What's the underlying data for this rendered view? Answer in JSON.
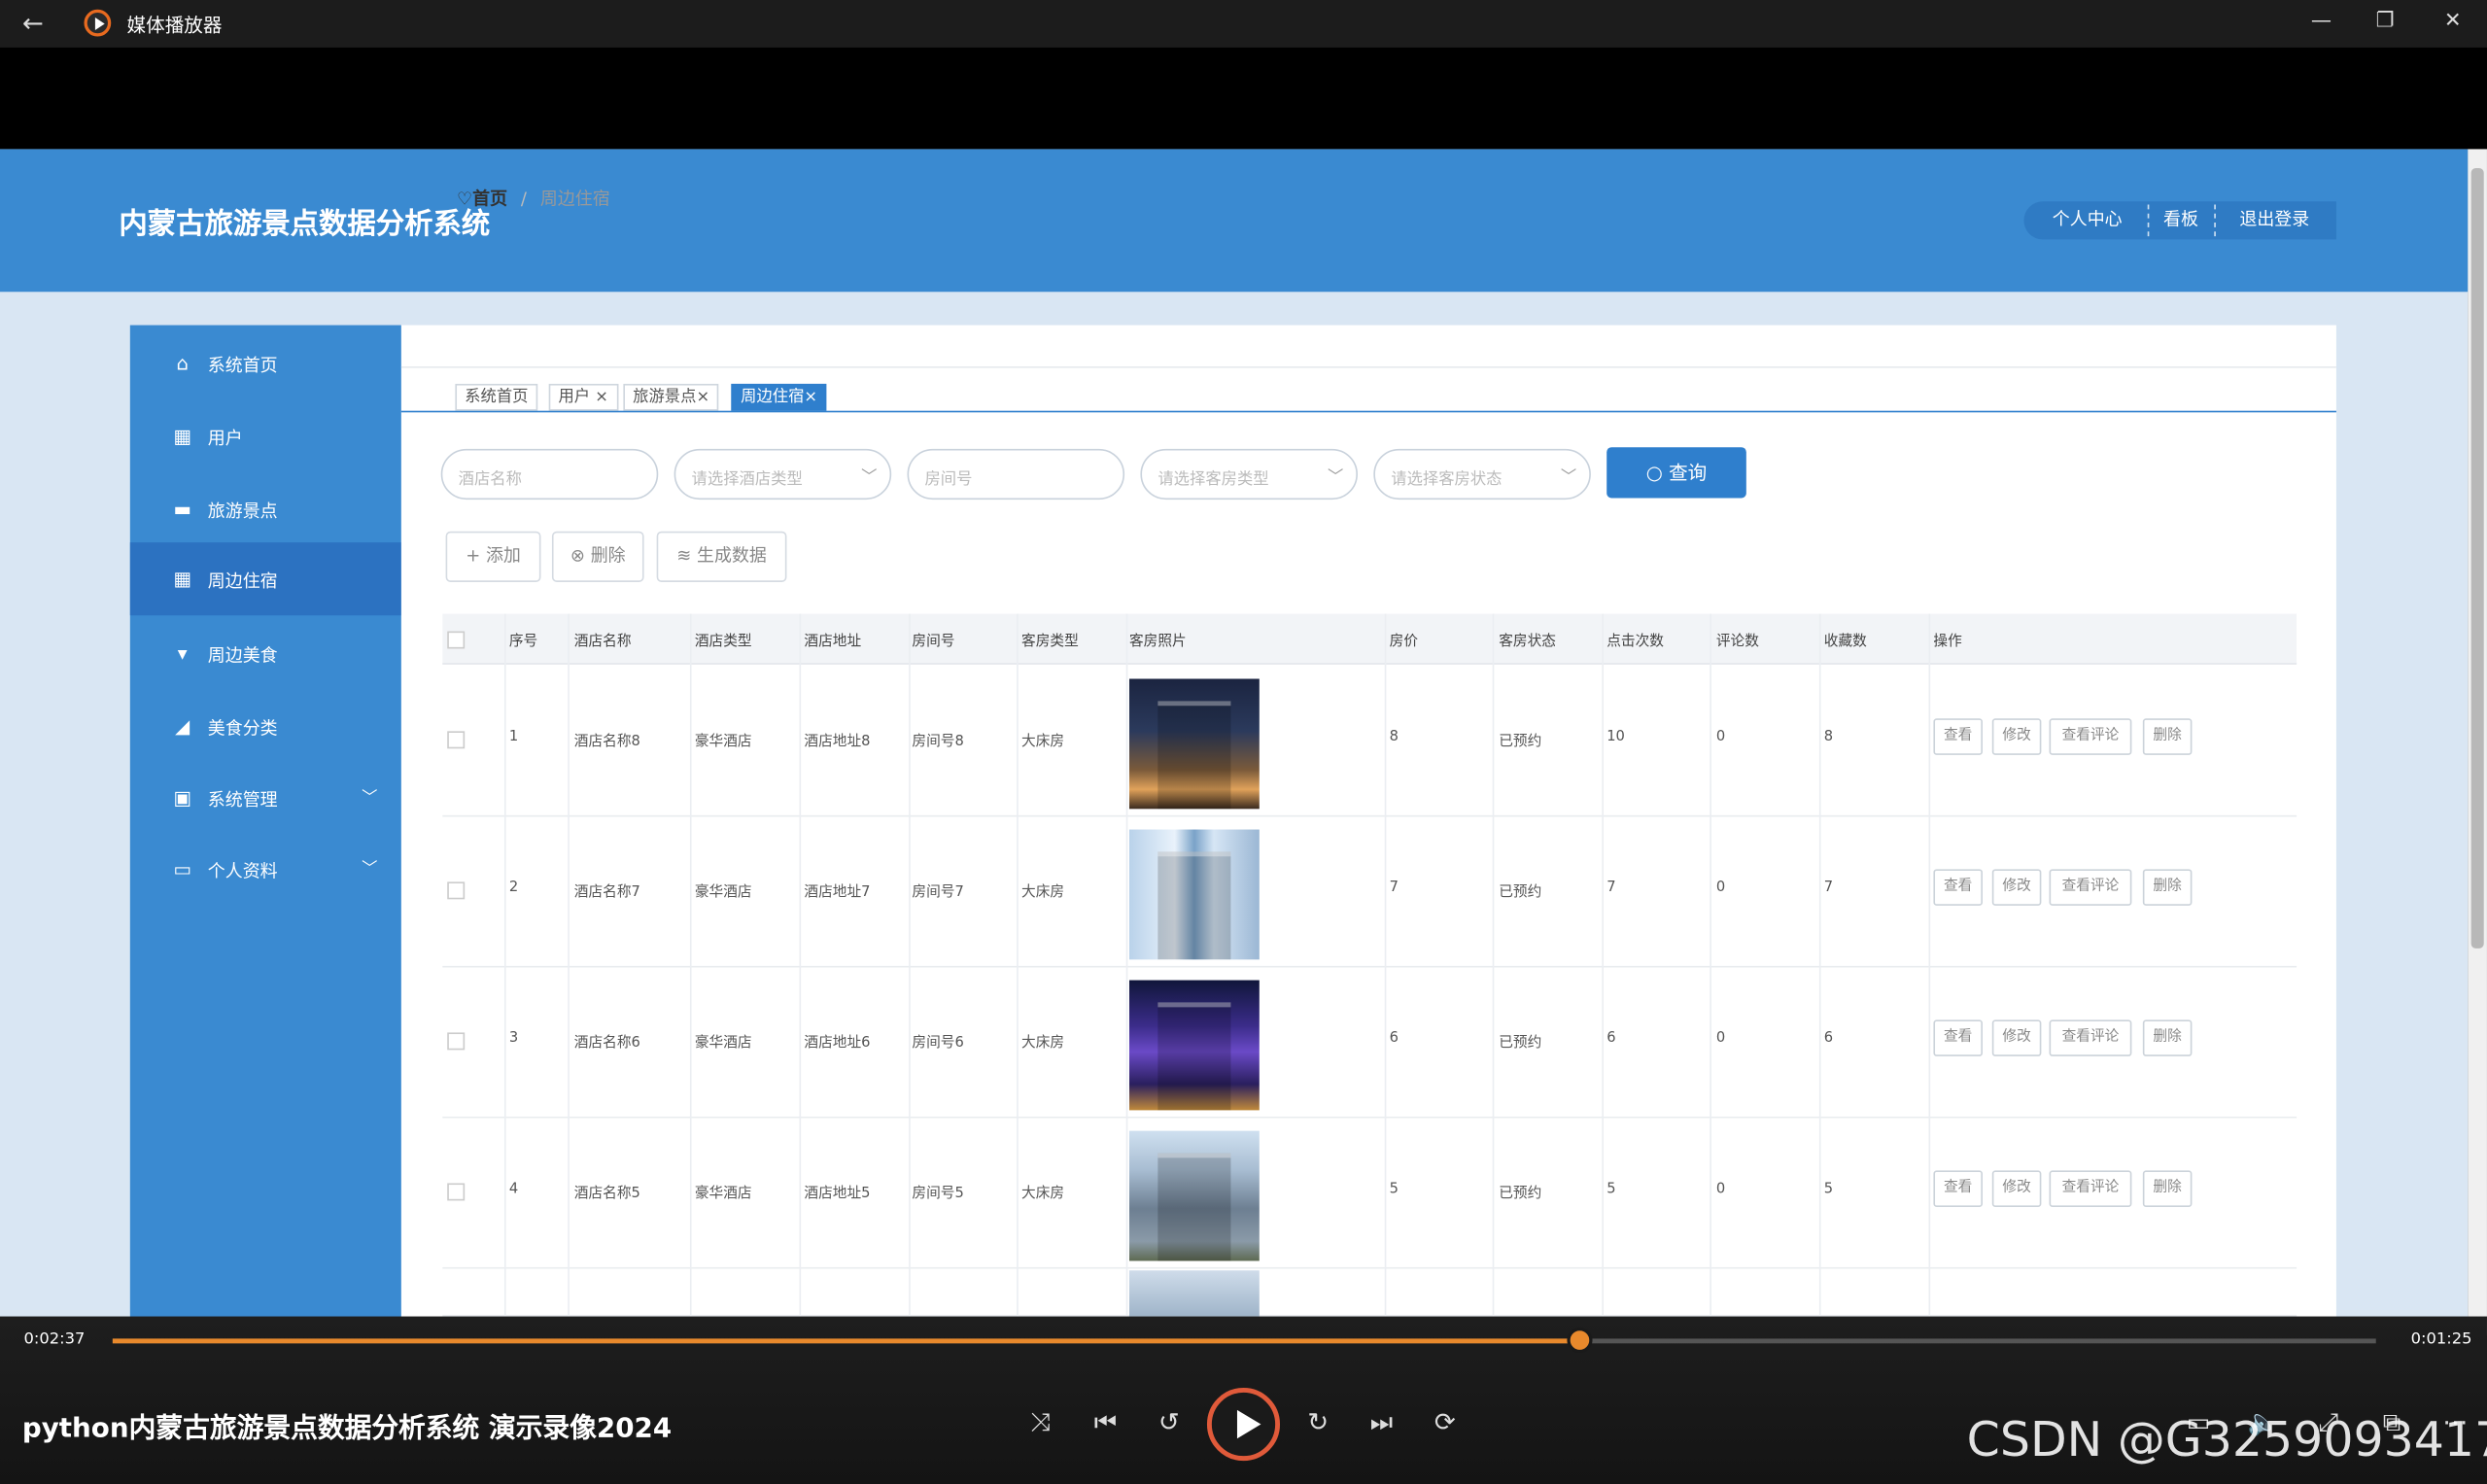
{
  "player": {
    "window_title": "媒体播放器",
    "current_time": "0:02:37",
    "total_time": "0:01:25",
    "progress": 0.648,
    "video_title": "python内蒙古旅游景点数据分析系统 演示录像2024",
    "watermark": "CSDN @G3259093417",
    "accent_color": "#e8892c"
  },
  "site": {
    "title": "内蒙古旅游景点数据分析系统",
    "nav": [
      "个人中心",
      "看板",
      "退出登录"
    ],
    "primary_color": "#3a8ad1"
  },
  "sidebar": {
    "items": [
      {
        "label": "系统首页",
        "icon": "home-icon"
      },
      {
        "label": "用户",
        "icon": "grid-icon"
      },
      {
        "label": "旅游景点",
        "icon": "chat-icon"
      },
      {
        "label": "周边住宿",
        "icon": "grid-icon",
        "active": true
      },
      {
        "label": "周边美食",
        "icon": "cup-icon"
      },
      {
        "label": "美食分类",
        "icon": "food-icon"
      },
      {
        "label": "系统管理",
        "icon": "clipboard-icon",
        "expandable": true
      },
      {
        "label": "个人资料",
        "icon": "card-icon",
        "expandable": true
      }
    ]
  },
  "breadcrumb": {
    "home": "首页",
    "sep": "/",
    "current": "周边住宿"
  },
  "tabs": [
    "系统首页",
    "用户",
    "旅游景点",
    "周边住宿"
  ],
  "filters": {
    "hotel_name": "酒店名称",
    "hotel_type": "请选择酒店类型",
    "room_no": "房间号",
    "room_type": "请选择客房类型",
    "room_status": "请选择客房状态",
    "query_label": "查询"
  },
  "actions": {
    "add": "添加",
    "delete": "删除",
    "generate": "生成数据"
  },
  "table": {
    "headers": [
      "序号",
      "酒店名称",
      "酒店类型",
      "酒店地址",
      "房间号",
      "客房类型",
      "客房照片",
      "房价",
      "客房状态",
      "点击次数",
      "评论数",
      "收藏数",
      "操作"
    ],
    "row_buttons": [
      "查看",
      "修改",
      "查看评论",
      "删除"
    ],
    "rows": [
      {
        "no": "1",
        "name": "酒店名称8",
        "type": "豪华酒店",
        "addr": "酒店地址8",
        "room": "房间号8",
        "rtype": "大床房",
        "price": "8",
        "status": "已预约",
        "clicks": "10",
        "comments": "0",
        "favs": "8",
        "photo": "hotel-night-facade"
      },
      {
        "no": "2",
        "name": "酒店名称7",
        "type": "豪华酒店",
        "addr": "酒店地址7",
        "room": "房间号7",
        "rtype": "大床房",
        "price": "7",
        "status": "已预约",
        "clicks": "7",
        "comments": "0",
        "favs": "7",
        "photo": "glass-tower"
      },
      {
        "no": "3",
        "name": "酒店名称6",
        "type": "豪华酒店",
        "addr": "酒店地址6",
        "room": "房间号6",
        "rtype": "大床房",
        "price": "6",
        "status": "已预约",
        "clicks": "6",
        "comments": "0",
        "favs": "6",
        "photo": "hotel-night-purple"
      },
      {
        "no": "4",
        "name": "酒店名称5",
        "type": "豪华酒店",
        "addr": "酒店地址5",
        "room": "房间号5",
        "rtype": "大床房",
        "price": "5",
        "status": "已预约",
        "clicks": "5",
        "comments": "0",
        "favs": "5",
        "photo": "hotel-day-building"
      }
    ]
  }
}
